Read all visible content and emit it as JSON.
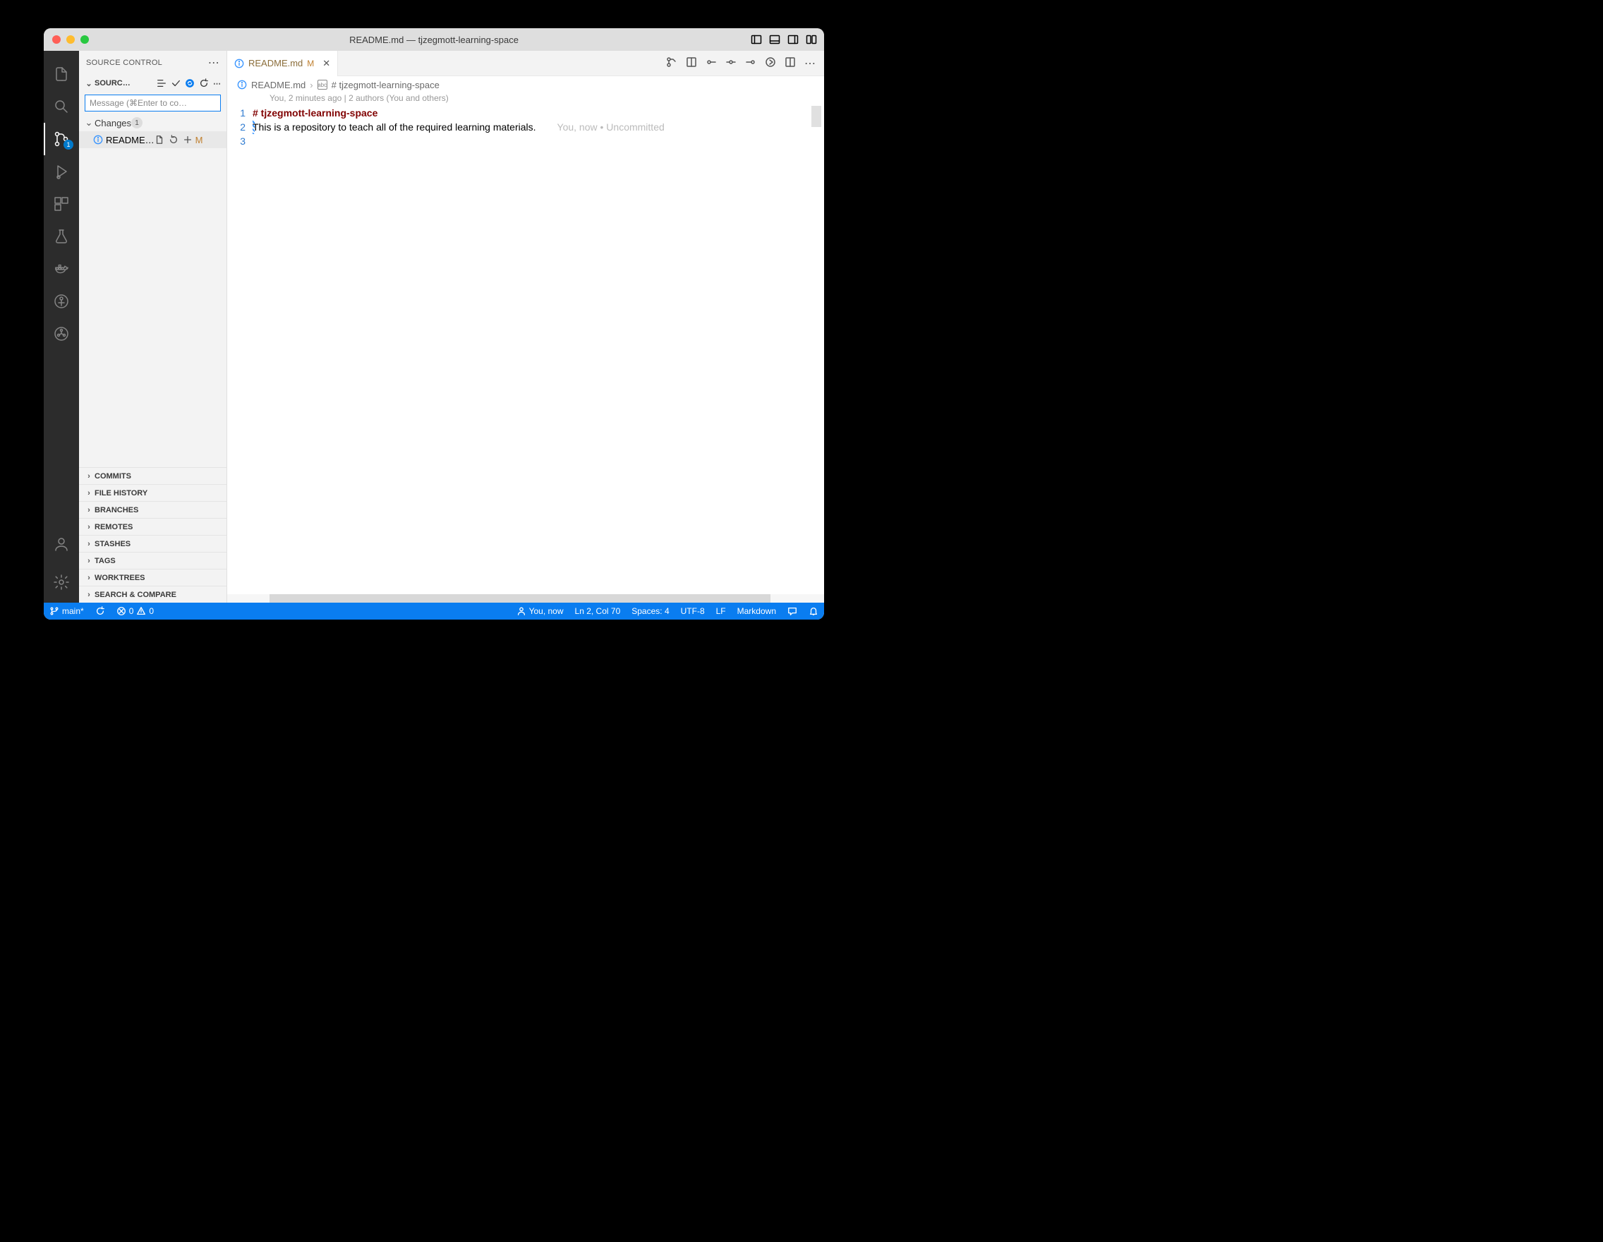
{
  "window_title": "README.md — tjzegmott-learning-space",
  "activitybar_badge": "1",
  "sidebar": {
    "title": "SOURCE CONTROL",
    "section_label": "SOURC…",
    "commit_placeholder": "Message (⌘Enter to co…",
    "changes_label": "Changes",
    "changes_count": "1",
    "file_label": "README…",
    "file_status": "M",
    "collapsed": [
      "COMMITS",
      "FILE HISTORY",
      "BRANCHES",
      "REMOTES",
      "STASHES",
      "TAGS",
      "WORKTREES",
      "SEARCH & COMPARE"
    ]
  },
  "tab": {
    "filename": "README.md",
    "status": "M"
  },
  "breadcrumb": {
    "file": "README.md",
    "heading": "# tjzegmott-learning-space"
  },
  "blame_summary": "You, 2 minutes ago | 2 authors (You and others)",
  "code": {
    "ln1": "1",
    "ln2": "2",
    "ln3": "3",
    "line1": "# tjzegmott-learning-space",
    "line2": "This is a repository to teach all of the required learning materials.",
    "inline_blame": "You, now • Uncommitted "
  },
  "status": {
    "branch": "main*",
    "errors": "0",
    "warnings": "0",
    "blame": "You, now",
    "pos": "Ln 2, Col 70",
    "spaces": "Spaces: 4",
    "encoding": "UTF-8",
    "eol": "LF",
    "lang": "Markdown"
  }
}
